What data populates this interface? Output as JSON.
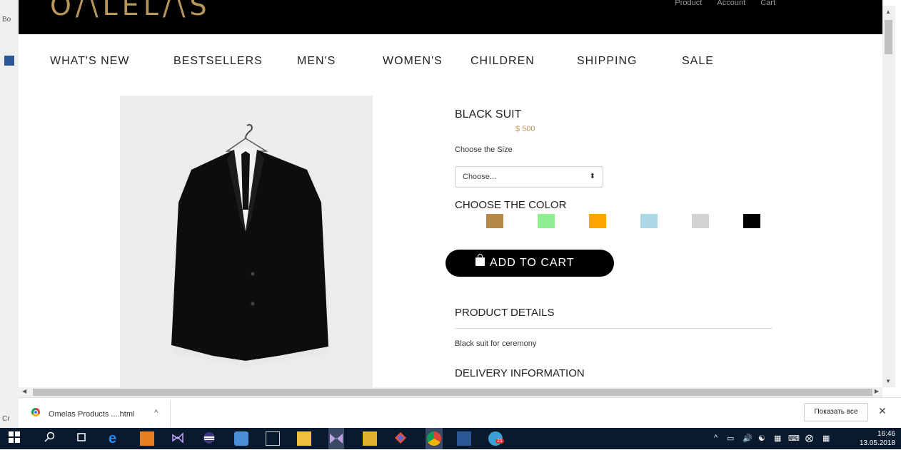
{
  "left_edge": {
    "texts": [
      "Bo",
      "Cr"
    ]
  },
  "header": {
    "logo": "O/\\LEL/\\S",
    "top_links": [
      "Product",
      "Account",
      "Cart"
    ]
  },
  "nav": {
    "items": [
      "WHAT'S NEW",
      "BESTSELLERS",
      "MEN'S",
      "WOMEN'S",
      "CHILDREN",
      "SHIPPING",
      "SALE"
    ]
  },
  "product": {
    "title": "BLACK SUIT",
    "price": "$ 500",
    "size_label": "Choose the Size",
    "size_select_value": "Choose...",
    "color_label": "CHOOSE THE COLOR",
    "colors": [
      "#b5894a",
      "#90ee90",
      "#ffa500",
      "#add8e6",
      "#d3d3d3",
      "#000000"
    ],
    "add_to_cart": "ADD TO CART",
    "details_title": "PRODUCT DETAILS",
    "details_text": "Black suit for ceremony",
    "delivery_title": "DELIVERY INFORMATION"
  },
  "download_bar": {
    "file_name": "Omelas Products ....html",
    "show_all": "Показать все"
  },
  "taskbar": {
    "time": "16:46",
    "date": "13.05.2018",
    "badge": "21"
  }
}
